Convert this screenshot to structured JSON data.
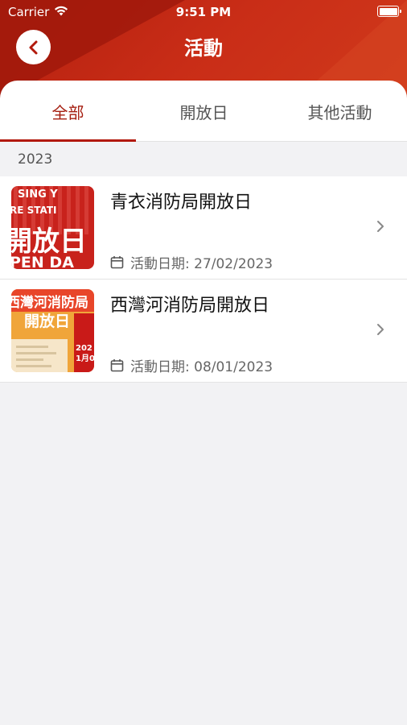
{
  "status_bar": {
    "carrier": "Carrier",
    "time": "9:51 PM"
  },
  "header": {
    "title": "活動"
  },
  "tabs": [
    {
      "label": "全部",
      "active": true
    },
    {
      "label": "開放日",
      "active": false
    },
    {
      "label": "其他活動",
      "active": false
    }
  ],
  "section": {
    "year": "2023"
  },
  "events": [
    {
      "title": "青衣消防局開放日",
      "date": "活動日期: 27/02/2023",
      "thumb_text": {
        "line1": "SING Y",
        "line2": "RE STATI",
        "line3": "開放日",
        "line4": "PEN DA"
      }
    },
    {
      "title": "西灣河消防局開放日",
      "date": "活動日期: 08/01/2023",
      "thumb_text": {
        "line1": "西灣河消防局",
        "line2": "開放日",
        "line3": "202",
        "line4": "1月0"
      }
    }
  ],
  "colors": {
    "brand_red": "#c62a14",
    "tab_active": "#a51e10",
    "background": "#f2f2f4"
  }
}
